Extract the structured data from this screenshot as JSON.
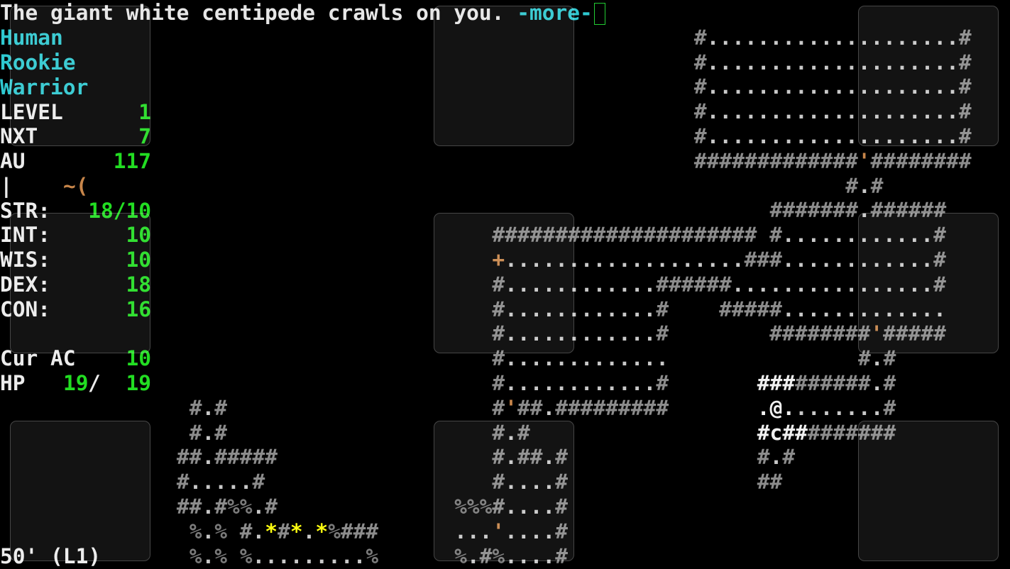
{
  "message": {
    "text": "The giant white centipede crawls on you.",
    "more": "-more-"
  },
  "sidebar": {
    "race": "Human",
    "title": "Rookie",
    "class": "Warrior",
    "stats": [
      {
        "label": "LEVEL",
        "value": "1"
      },
      {
        "label": "NXT",
        "value": "7"
      },
      {
        "label": "AU",
        "value": "117"
      }
    ],
    "equipment": {
      "bar": "|",
      "items": "~("
    },
    "attributes": [
      {
        "label": "STR:",
        "value": "18/10"
      },
      {
        "label": "INT:",
        "value": "10"
      },
      {
        "label": "WIS:",
        "value": "10"
      },
      {
        "label": "DEX:",
        "value": "18"
      },
      {
        "label": "CON:",
        "value": "16"
      }
    ],
    "ac": {
      "label": "Cur AC",
      "value": "10"
    },
    "hp": {
      "label": "HP",
      "current": "19",
      "sep": "/",
      "max": "19"
    },
    "depth": "50' (L1)"
  },
  "colors": {
    "cyan": "#2ec8d0",
    "green": "#22dd22",
    "wall": "#8c8c8c",
    "floor": "#c8c8c8",
    "door": "#c8864a",
    "mineral": "#ffff10"
  },
  "map": {
    "segments": [
      {
        "row": 1,
        "col": 55,
        "text": "#....................#"
      },
      {
        "row": 2,
        "col": 55,
        "text": "#....................#"
      },
      {
        "row": 3,
        "col": 55,
        "text": "#....................#"
      },
      {
        "row": 4,
        "col": 55,
        "text": "#....................#"
      },
      {
        "row": 5,
        "col": 55,
        "text": "#....................#"
      },
      {
        "row": 6,
        "col": 55,
        "text": "#############'########"
      },
      {
        "row": 7,
        "col": 67,
        "text": "#.#"
      },
      {
        "row": 8,
        "col": 61,
        "text": "#######.######"
      },
      {
        "row": 9,
        "col": 39,
        "text": "##################### #............#"
      },
      {
        "row": 10,
        "col": 39,
        "text": "+...................###............#"
      },
      {
        "row": 11,
        "col": 39,
        "text": "#............######................#"
      },
      {
        "row": 12,
        "col": 39,
        "text": "#............#    #####............."
      },
      {
        "row": 13,
        "col": 39,
        "text": "#............#        ########'#####"
      },
      {
        "row": 14,
        "col": 39,
        "text": "#............."
      },
      {
        "row": 14,
        "col": 68,
        "text": "#.#"
      },
      {
        "row": 15,
        "col": 39,
        "text": "#............#"
      },
      {
        "row": 15,
        "col": 60,
        "text": "###",
        "lit": true
      },
      {
        "row": 15,
        "col": 63,
        "text": "######.#"
      },
      {
        "row": 16,
        "col": 15,
        "text": "#.#"
      },
      {
        "row": 16,
        "col": 39,
        "text": "#'##.#########"
      },
      {
        "row": 16,
        "col": 60,
        "text": ".@.",
        "lit": true
      },
      {
        "row": 16,
        "col": 63,
        "text": ".......#"
      },
      {
        "row": 17,
        "col": 15,
        "text": "#.#"
      },
      {
        "row": 17,
        "col": 39,
        "text": "#.#"
      },
      {
        "row": 17,
        "col": 60,
        "text": "#c##",
        "lit": true
      },
      {
        "row": 17,
        "col": 64,
        "text": "#######"
      },
      {
        "row": 18,
        "col": 14,
        "text": "##.#####"
      },
      {
        "row": 18,
        "col": 39,
        "text": "#.##.#"
      },
      {
        "row": 18,
        "col": 60,
        "text": "#.#"
      },
      {
        "row": 19,
        "col": 14,
        "text": "#.....#"
      },
      {
        "row": 19,
        "col": 39,
        "text": "#....#"
      },
      {
        "row": 19,
        "col": 60,
        "text": "##"
      },
      {
        "row": 20,
        "col": 14,
        "text": "##.#%%.#"
      },
      {
        "row": 20,
        "col": 36,
        "text": "%%%#....#"
      },
      {
        "row": 21,
        "col": 15,
        "text": "%.% #.*#*.*%###"
      },
      {
        "row": 21,
        "col": 36,
        "text": "...'....#"
      },
      {
        "row": 22,
        "col": 15,
        "text": "%.% %.........%"
      },
      {
        "row": 22,
        "col": 36,
        "text": "%.#%....#"
      }
    ]
  },
  "touch_overlays": [
    "top-left",
    "top-center",
    "top-right",
    "middle-left",
    "middle-center",
    "middle-right",
    "bottom-left",
    "bottom-center",
    "bottom-right"
  ]
}
